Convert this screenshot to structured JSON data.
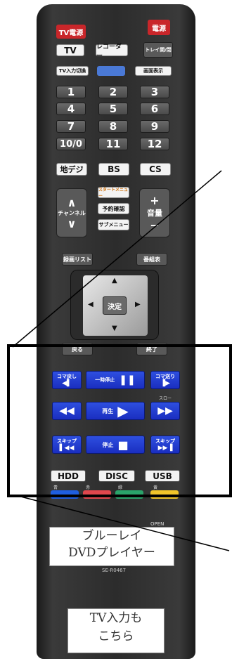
{
  "buttons": {
    "tv_power": "TV電源",
    "power": "電源",
    "tv": "TV",
    "recorder": "レコーダー",
    "tray": "トレイ開/閉",
    "tv_input": "TV入力切換",
    "display": "画面表示",
    "numbers": [
      "1",
      "2",
      "3",
      "4",
      "5",
      "6",
      "7",
      "8",
      "9",
      "10/0",
      "11",
      "12"
    ],
    "terrestrial": "地デジ",
    "bs": "BS",
    "cs": "CS",
    "channel": "チャンネル",
    "start_menu": "スタートメニュー",
    "reservation": "予約確認",
    "submenu": "サブメニュー",
    "volume": "音量",
    "plus": "+",
    "minus": "−",
    "record_list": "録画リスト",
    "program_guide": "番組表",
    "enter": "決定",
    "back": "戻る",
    "close": "終了",
    "frame_back": "コマ戻し",
    "pause": "一時停止",
    "frame_fwd": "コマ送り",
    "slow": "スロー",
    "play": "再生",
    "skip_back": "スキップ",
    "stop": "停止",
    "skip_fwd": "スキップ",
    "hdd": "HDD",
    "disc": "DISC",
    "usb": "USB",
    "color_blue": "青",
    "color_red": "赤",
    "color_green": "緑",
    "color_yellow": "黄",
    "open": "OPEN"
  },
  "labels": {
    "player_line1": "ブルーレイ",
    "player_line2": "DVDプレイヤー",
    "model": "SE-R0467",
    "tv_input_line1": "TV入力も",
    "tv_input_line2": "こちら"
  },
  "colors": {
    "blue_key": "#1f5fe0",
    "red_key": "#e0474d",
    "green_key": "#2aa36a",
    "yellow_key": "#f1c52a"
  }
}
